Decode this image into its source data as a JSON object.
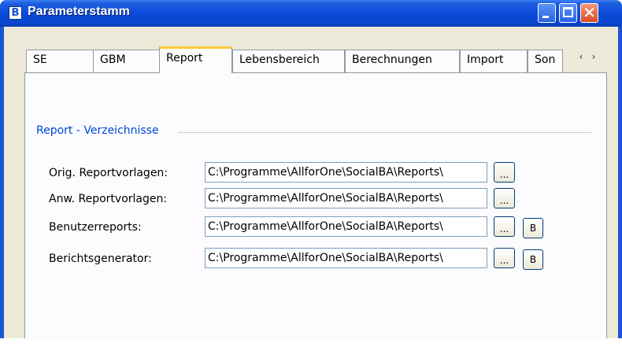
{
  "window": {
    "title": "Parameterstamm",
    "app_icon_letter": "B",
    "close_glyph": "✕"
  },
  "tabs": [
    {
      "label": "SE"
    },
    {
      "label": "GBM"
    },
    {
      "label": "Report",
      "active": true
    },
    {
      "label": "Lebensbereich"
    },
    {
      "label": "Berechnungen"
    },
    {
      "label": "Import"
    },
    {
      "label": "Son"
    }
  ],
  "tab_scroll": {
    "left": "‹",
    "right": "›"
  },
  "group": {
    "legend": "Report - Verzeichnisse"
  },
  "rows": [
    {
      "label": "Orig. Reportvorlagen:",
      "path": "C:\\Programme\\AllforOne\\SocialBA\\Reports\\",
      "browse": "...",
      "b_button": null
    },
    {
      "label": "Anw. Reportvorlagen:",
      "path": "C:\\Programme\\AllforOne\\SocialBA\\Reports\\",
      "browse": "...",
      "b_button": null
    },
    {
      "label": "Benutzerreports:",
      "path": "C:\\Programme\\AllforOne\\SocialBA\\Reports\\",
      "browse": "...",
      "b_button": "B"
    },
    {
      "label": "Berichtsgenerator:",
      "path": "C:\\Programme\\AllforOne\\SocialBA\\Reports\\",
      "browse": "...",
      "b_button": "B"
    }
  ],
  "colors": {
    "title_bar": "#0a4ad8",
    "accent_tab": "#ffc83c",
    "group_text": "#0046d5",
    "window_bg": "#ece9d8"
  }
}
